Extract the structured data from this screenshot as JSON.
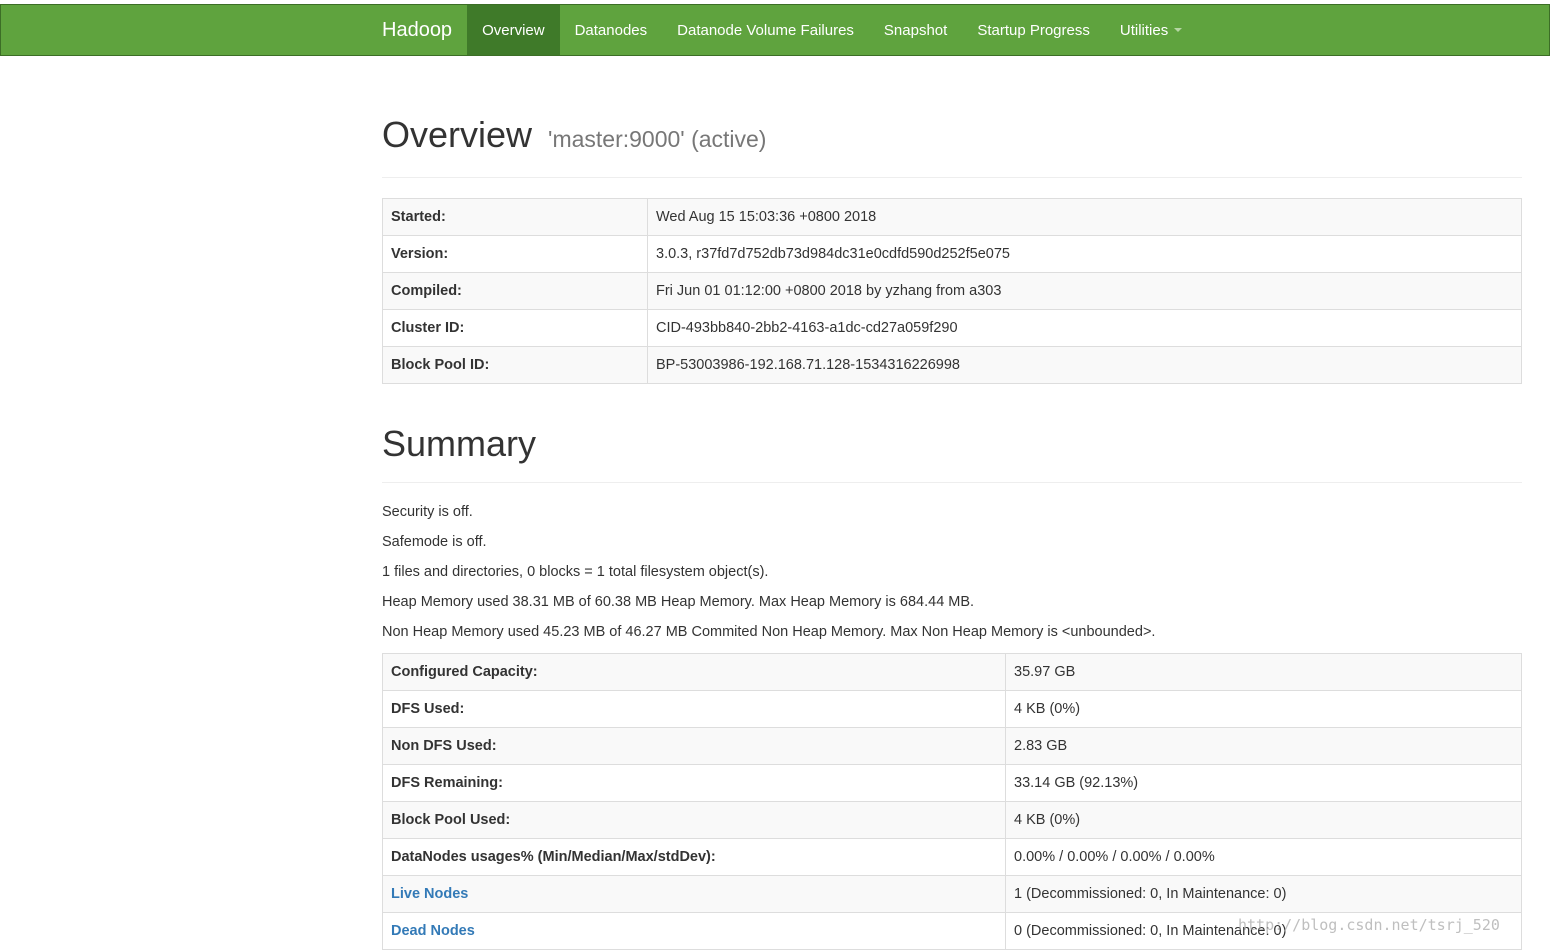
{
  "nav": {
    "brand": "Hadoop",
    "items": [
      {
        "label": "Overview",
        "active": true
      },
      {
        "label": "Datanodes",
        "active": false
      },
      {
        "label": "Datanode Volume Failures",
        "active": false
      },
      {
        "label": "Snapshot",
        "active": false
      },
      {
        "label": "Startup Progress",
        "active": false
      },
      {
        "label": "Utilities",
        "active": false,
        "dropdown": true
      }
    ]
  },
  "overview": {
    "title": "Overview",
    "subtitle": "'master:9000' (active)",
    "rows": [
      {
        "label": "Started:",
        "value": "Wed Aug 15 15:03:36 +0800 2018"
      },
      {
        "label": "Version:",
        "value": "3.0.3, r37fd7d752db73d984dc31e0cdfd590d252f5e075"
      },
      {
        "label": "Compiled:",
        "value": "Fri Jun 01 01:12:00 +0800 2018 by yzhang from a303"
      },
      {
        "label": "Cluster ID:",
        "value": "CID-493bb840-2bb2-4163-a1dc-cd27a059f290"
      },
      {
        "label": "Block Pool ID:",
        "value": "BP-53003986-192.168.71.128-1534316226998"
      }
    ]
  },
  "summary": {
    "title": "Summary",
    "lines": [
      "Security is off.",
      "Safemode is off.",
      "1 files and directories, 0 blocks = 1 total filesystem object(s).",
      "Heap Memory used 38.31 MB of 60.38 MB Heap Memory. Max Heap Memory is 684.44 MB.",
      "Non Heap Memory used 45.23 MB of 46.27 MB Commited Non Heap Memory. Max Non Heap Memory is <unbounded>."
    ],
    "rows": [
      {
        "label": "Configured Capacity:",
        "value": "35.97 GB"
      },
      {
        "label": "DFS Used:",
        "value": "4 KB (0%)"
      },
      {
        "label": "Non DFS Used:",
        "value": "2.83 GB"
      },
      {
        "label": "DFS Remaining:",
        "value": "33.14 GB (92.13%)"
      },
      {
        "label": "Block Pool Used:",
        "value": "4 KB (0%)"
      },
      {
        "label": "DataNodes usages% (Min/Median/Max/stdDev):",
        "value": "0.00% / 0.00% / 0.00% / 0.00%"
      },
      {
        "label": "Live Nodes",
        "value": "1 (Decommissioned: 0, In Maintenance: 0)"
      },
      {
        "label": "Dead Nodes",
        "value": "0 (Decommissioned: 0, In Maintenance: 0)"
      }
    ]
  },
  "watermark": "http://blog.csdn.net/tsrj_520",
  "colors": {
    "navbar": "#5fa33e",
    "navbar_active": "#3f7a29",
    "link": "#337ab7"
  }
}
